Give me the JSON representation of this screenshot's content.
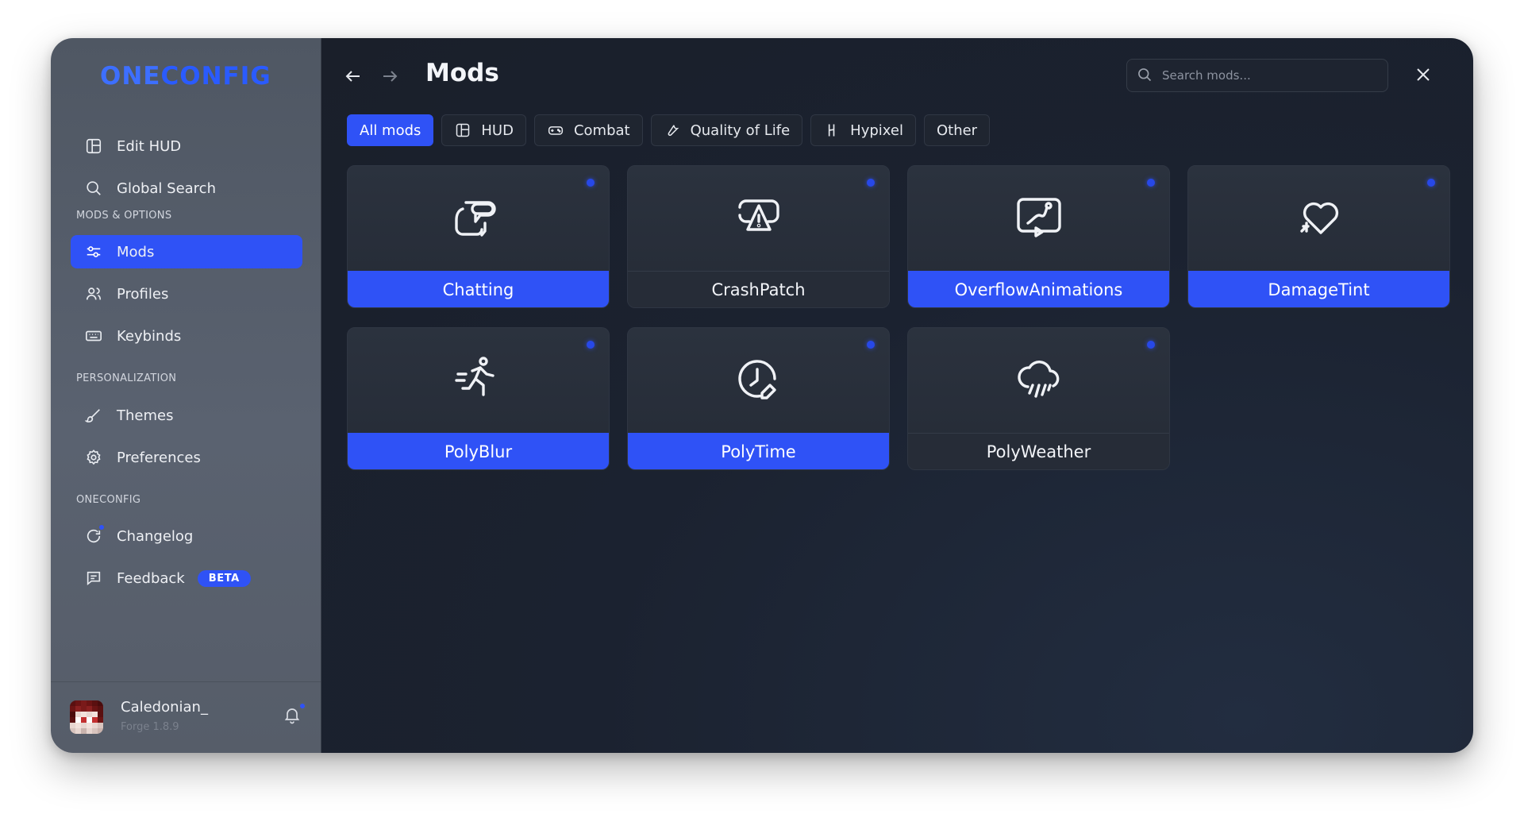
{
  "window": {
    "accent": "#2f52f6"
  },
  "sidebar": {
    "logo_one": "ONE",
    "logo_config": "CONFIG",
    "top_items": [
      {
        "label": "Edit HUD",
        "icon": "layout-icon"
      },
      {
        "label": "Global Search",
        "icon": "search-icon"
      }
    ],
    "sections": [
      {
        "title": "MODS & OPTIONS",
        "items": [
          {
            "label": "Mods",
            "icon": "sliders-icon",
            "active": true
          },
          {
            "label": "Profiles",
            "icon": "users-icon"
          },
          {
            "label": "Keybinds",
            "icon": "keyboard-icon"
          }
        ]
      },
      {
        "title": "PERSONALIZATION",
        "items": [
          {
            "label": "Themes",
            "icon": "brush-icon"
          },
          {
            "label": "Preferences",
            "icon": "gear-icon"
          }
        ]
      },
      {
        "title": "ONECONFIG",
        "items": [
          {
            "label": "Changelog",
            "icon": "refresh-icon"
          },
          {
            "label": "Feedback",
            "icon": "message-icon",
            "badge": "BETA"
          }
        ]
      }
    ],
    "profile": {
      "username": "Caledonian_",
      "subtext": "Forge 1.8.9"
    }
  },
  "header": {
    "title": "Mods",
    "search_placeholder": "Search mods..."
  },
  "tabs": [
    {
      "label": "All mods",
      "active": true,
      "icon": ""
    },
    {
      "label": "HUD",
      "icon": "layout-icon"
    },
    {
      "label": "Combat",
      "icon": "gamepad-icon"
    },
    {
      "label": "Quality of Life",
      "icon": "wrench-icon"
    },
    {
      "label": "Hypixel",
      "icon": "hypixel-icon"
    },
    {
      "label": "Other",
      "icon": ""
    }
  ],
  "mods": [
    {
      "name": "Chatting",
      "icon": "chat-icon",
      "enabled": true
    },
    {
      "name": "CrashPatch",
      "icon": "crash-icon",
      "enabled": false
    },
    {
      "name": "OverflowAnimations",
      "icon": "animation-icon",
      "enabled": true
    },
    {
      "name": "DamageTint",
      "icon": "heart-icon",
      "enabled": true
    },
    {
      "name": "PolyBlur",
      "icon": "runner-icon",
      "enabled": true
    },
    {
      "name": "PolyTime",
      "icon": "clock-icon",
      "enabled": true
    },
    {
      "name": "PolyWeather",
      "icon": "weather-icon",
      "enabled": false
    }
  ]
}
